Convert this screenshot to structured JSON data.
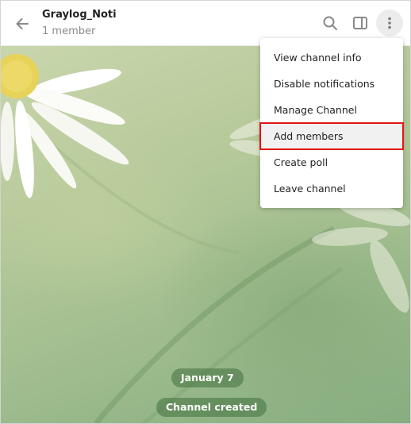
{
  "header": {
    "title": "Graylog_Noti",
    "subtitle": "1 member",
    "icons": {
      "back": "back-arrow-icon",
      "search": "search-icon",
      "panel": "sidebar-toggle-icon",
      "more": "more-vertical-icon"
    }
  },
  "menu": {
    "items": [
      {
        "label": "View channel info"
      },
      {
        "label": "Disable notifications"
      },
      {
        "label": "Manage Channel"
      },
      {
        "label": "Add members",
        "highlighted": true
      },
      {
        "label": "Create poll"
      },
      {
        "label": "Leave channel"
      }
    ],
    "highlight_color": "#e01616"
  },
  "chat": {
    "date_label": "January 7",
    "service_message": "Channel created"
  }
}
